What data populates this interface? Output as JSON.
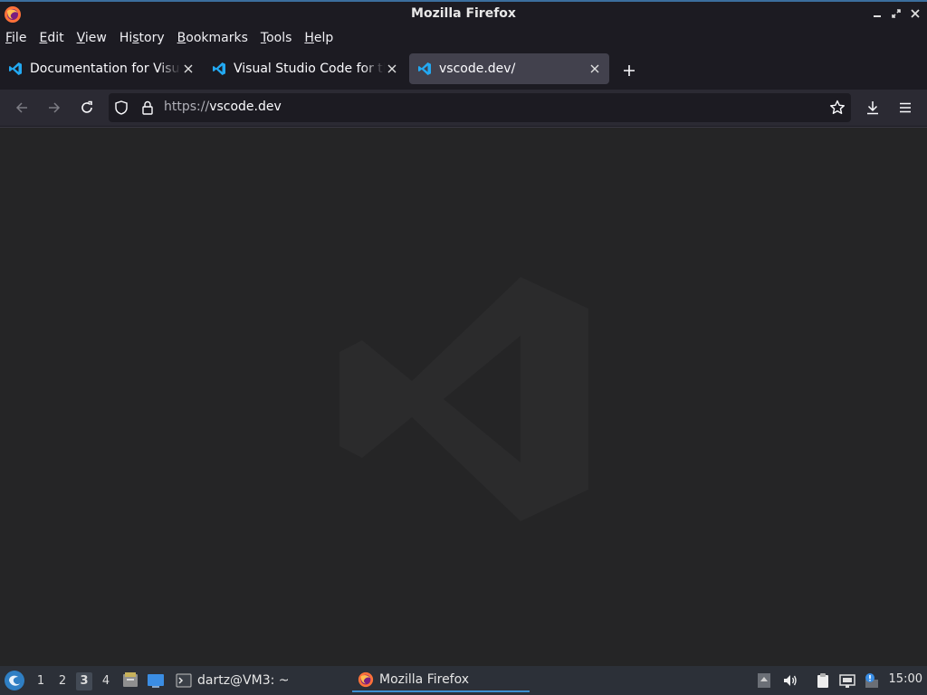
{
  "window": {
    "title": "Mozilla Firefox"
  },
  "menu": {
    "items": [
      {
        "label": "File",
        "key": "F",
        "rest": "ile"
      },
      {
        "label": "Edit",
        "key": "E",
        "rest": "dit"
      },
      {
        "label": "View",
        "key": "V",
        "rest": "iew"
      },
      {
        "label": "History",
        "key": "s",
        "pre": "Hi",
        "rest": "tory"
      },
      {
        "label": "Bookmarks",
        "key": "B",
        "rest": "ookmarks"
      },
      {
        "label": "Tools",
        "key": "T",
        "rest": "ools"
      },
      {
        "label": "Help",
        "key": "H",
        "rest": "elp"
      }
    ]
  },
  "tabs": [
    {
      "label": "Documentation for Visual Studio Code",
      "icon": "vscode-icon",
      "active": false
    },
    {
      "label": "Visual Studio Code for the Web",
      "icon": "vscode-icon",
      "active": false
    },
    {
      "label": "vscode.dev/",
      "icon": "vscode-icon",
      "active": true
    }
  ],
  "navbar": {
    "url_scheme": "https://",
    "url_host": "vscode.dev"
  },
  "taskbar": {
    "workspaces": [
      "1",
      "2",
      "3",
      "4"
    ],
    "current_workspace": "3",
    "tasks": [
      {
        "label": "dartz@VM3: ~",
        "icon": "terminal-icon"
      },
      {
        "label": "Mozilla Firefox",
        "icon": "firefox-icon",
        "active": true
      }
    ],
    "clock": "15:00"
  },
  "colors": {
    "chrome_bg": "#1c1b22",
    "toolbar_bg": "#2b2a33",
    "active_tab_bg": "#42414d",
    "content_bg": "#252526",
    "taskbar_bg": "#2c3038",
    "vscode_blue": "#23a9f2"
  }
}
